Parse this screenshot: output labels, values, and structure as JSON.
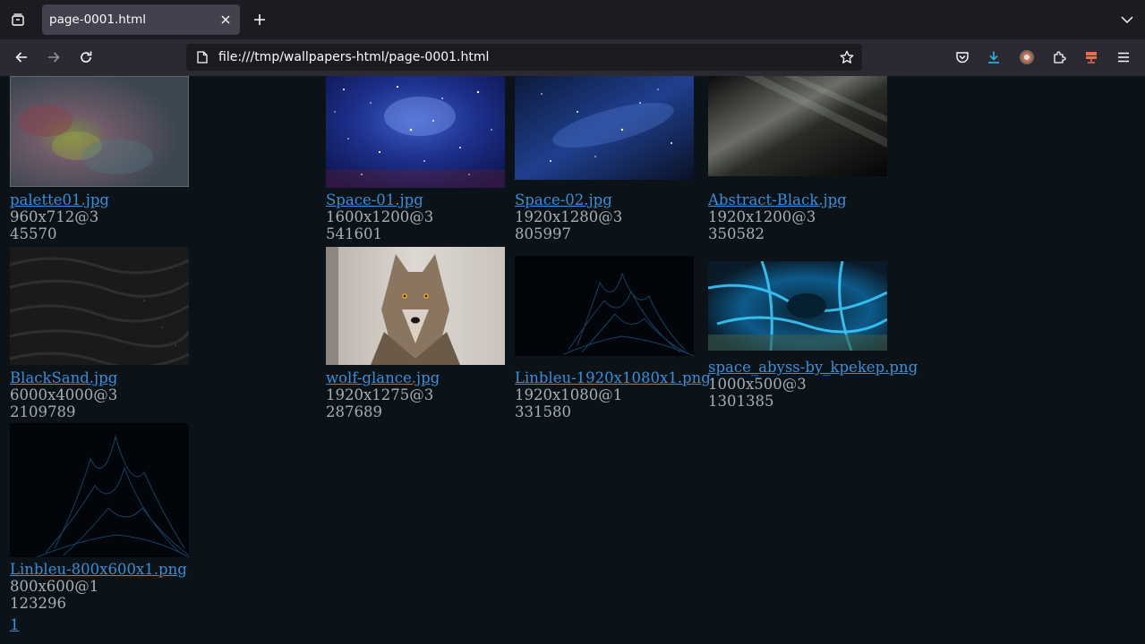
{
  "browser": {
    "tab_title": "page-0001.html",
    "url": "file:///tmp/wallpapers-html/page-0001.html"
  },
  "items": [
    {
      "name": "palette01.jpg",
      "dims": "960x712@3",
      "size": "45570"
    },
    {
      "name": "Space-01.jpg",
      "dims": "1600x1200@3",
      "size": "541601"
    },
    {
      "name": "Space-02.jpg",
      "dims": "1920x1280@3",
      "size": "805997"
    },
    {
      "name": "Abstract-Black.jpg",
      "dims": "1920x1200@3",
      "size": "350582"
    },
    {
      "name": "BlackSand.jpg",
      "dims": "6000x4000@3",
      "size": "2109789"
    },
    {
      "name": "wolf-glance.jpg",
      "dims": "1920x1275@3",
      "size": "287689"
    },
    {
      "name": "Linbleu-1920x1080x1.png",
      "dims": "1920x1080@1",
      "size": "331580"
    },
    {
      "name": "space_abyss-by_kpekep.png",
      "dims": "1000x500@3",
      "size": "1301385"
    },
    {
      "name": "Linbleu-800x600x1.png",
      "dims": "800x600@1",
      "size": "123296"
    }
  ],
  "pagination": {
    "page_1": "1"
  }
}
